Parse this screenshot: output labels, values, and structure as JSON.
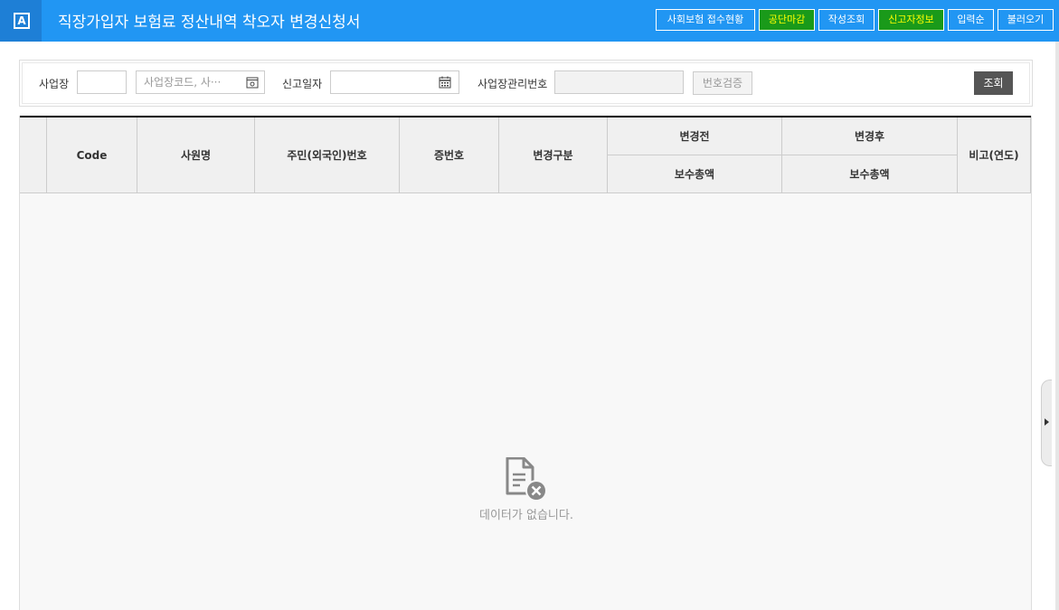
{
  "titlebar": {
    "logo_letter": "A",
    "title": "직장가입자 보험료 정산내역 착오자 변경신청서",
    "buttons": [
      {
        "label": "사회보험 접수현황",
        "style": "blue"
      },
      {
        "label": "공단마감",
        "style": "green"
      },
      {
        "label": "작성조회",
        "style": "blue"
      },
      {
        "label": "신고자정보",
        "style": "green"
      },
      {
        "label": "입력순",
        "style": "blue"
      },
      {
        "label": "불러오기",
        "style": "blue"
      }
    ]
  },
  "search": {
    "workplace_label": "사업장",
    "workplace_code_value": "",
    "workplace_name_placeholder": "사업장코드, 사···",
    "report_date_label": "신고일자",
    "report_date_value": "",
    "mgmt_no_label": "사업장관리번호",
    "mgmt_no_value": "",
    "verify_label": "번호검증",
    "search_label": "조회"
  },
  "grid": {
    "columns": {
      "code": "Code",
      "name": "사원명",
      "resident_no": "주민(외국인)번호",
      "cert_no": "증번호",
      "change_type": "변경구분",
      "before": "변경전",
      "before_sub": "보수총액",
      "after": "변경후",
      "after_sub": "보수총액",
      "remarks": "비고(연도)"
    },
    "rows": [],
    "empty_message": "데이터가 없습니다."
  },
  "colors": {
    "titlebar": "#2196f3",
    "green_button": "#1a9a1a",
    "green_button_text": "#ffff00",
    "search_button": "#555555"
  }
}
